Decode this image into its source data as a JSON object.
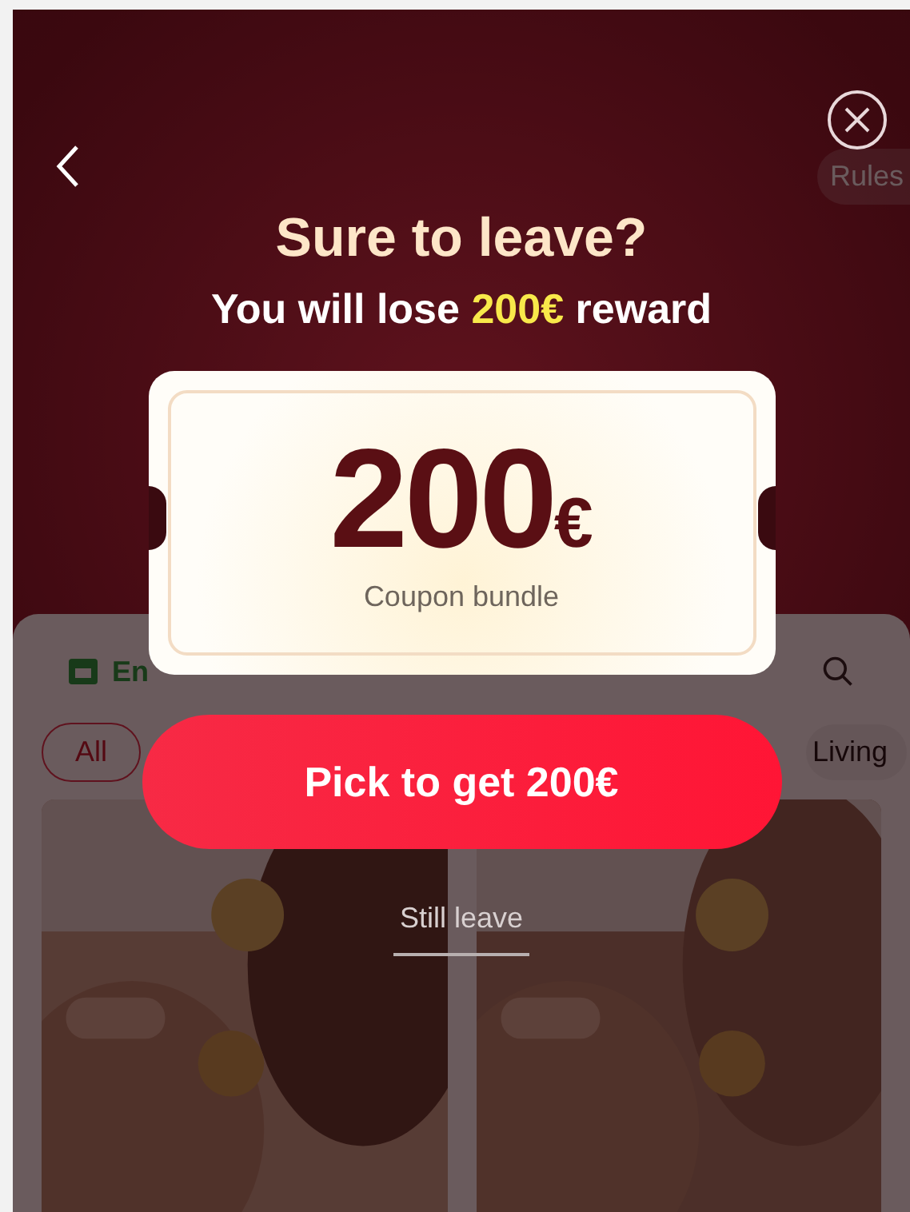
{
  "page": {
    "rules": "Rules",
    "search_label": "En",
    "chips": [
      {
        "label": "All",
        "selected": true
      },
      {
        "label": "Living",
        "selected": false
      }
    ]
  },
  "dialog": {
    "title": "Sure to leave?",
    "subtitle": {
      "before": "You will lose",
      "highlight": "200€",
      "after": "reward"
    },
    "coupon": {
      "amount": "200",
      "currency": "€",
      "caption": "Coupon bundle"
    },
    "primary_button": "Pick to get 200€",
    "secondary_link": "Still leave"
  }
}
